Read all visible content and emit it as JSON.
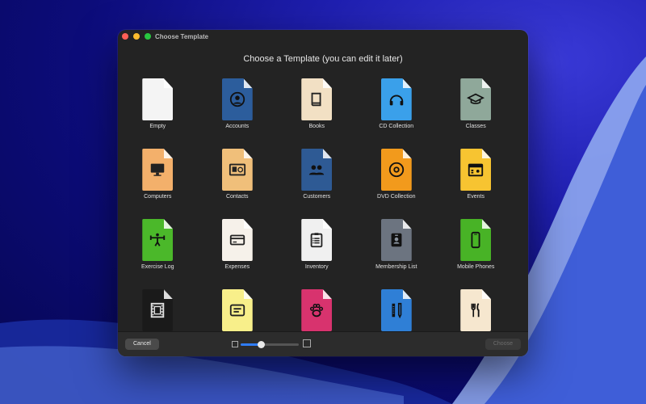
{
  "window": {
    "title": "Choose Template",
    "heading": "Choose a Template (you can edit it later)"
  },
  "templates": [
    {
      "label": "Empty",
      "icon": "blank-document-icon",
      "bg": "#f4f4f4",
      "fg": "#333333"
    },
    {
      "label": "Accounts",
      "icon": "person-circle-icon",
      "bg": "#2c5d9c",
      "fg": "#111111"
    },
    {
      "label": "Books",
      "icon": "book-icon",
      "bg": "#f2e0c4",
      "fg": "#222222"
    },
    {
      "label": "CD Collection",
      "icon": "headphones-icon",
      "bg": "#3aa0ea",
      "fg": "#111111"
    },
    {
      "label": "Classes",
      "icon": "graduation-cap-icon",
      "bg": "#8fa89a",
      "fg": "#111111"
    },
    {
      "label": "Computers",
      "icon": "desktop-computer-icon",
      "bg": "#f3b06b",
      "fg": "#222222"
    },
    {
      "label": "Contacts",
      "icon": "contact-card-icon",
      "bg": "#f0bf7a",
      "fg": "#222222"
    },
    {
      "label": "Customers",
      "icon": "people-icon",
      "bg": "#2e5a94",
      "fg": "#111111"
    },
    {
      "label": "DVD Collection",
      "icon": "disc-icon",
      "bg": "#f29a1c",
      "fg": "#111111"
    },
    {
      "label": "Events",
      "icon": "calendar-person-icon",
      "bg": "#f7c431",
      "fg": "#111111"
    },
    {
      "label": "Exercise Log",
      "icon": "weightlifter-icon",
      "bg": "#4bb82a",
      "fg": "#111111"
    },
    {
      "label": "Expenses",
      "icon": "credit-card-icon",
      "bg": "#f6f1ea",
      "fg": "#222222"
    },
    {
      "label": "Inventory",
      "icon": "clipboard-list-icon",
      "bg": "#f0f0f0",
      "fg": "#222222"
    },
    {
      "label": "Membership List",
      "icon": "id-badge-icon",
      "bg": "#6c7480",
      "fg": "#111111"
    },
    {
      "label": "Mobile Phones",
      "icon": "mobile-phone-icon",
      "bg": "#48b326",
      "fg": "#111111"
    },
    {
      "label": "",
      "icon": "film-strip-icon",
      "bg": "#1a1a1a",
      "fg": "#e0e0e0"
    },
    {
      "label": "",
      "icon": "note-icon",
      "bg": "#f8ef8a",
      "fg": "#222222"
    },
    {
      "label": "",
      "icon": "paw-icon",
      "bg": "#d8336e",
      "fg": "#111111"
    },
    {
      "label": "",
      "icon": "ruler-pencil-icon",
      "bg": "#2f7fd6",
      "fg": "#111111"
    },
    {
      "label": "",
      "icon": "fork-knife-icon",
      "bg": "#f6e7cf",
      "fg": "#111111"
    }
  ],
  "footer": {
    "cancel_label": "Cancel",
    "choose_label": "Choose",
    "zoom_level": 0.35
  }
}
